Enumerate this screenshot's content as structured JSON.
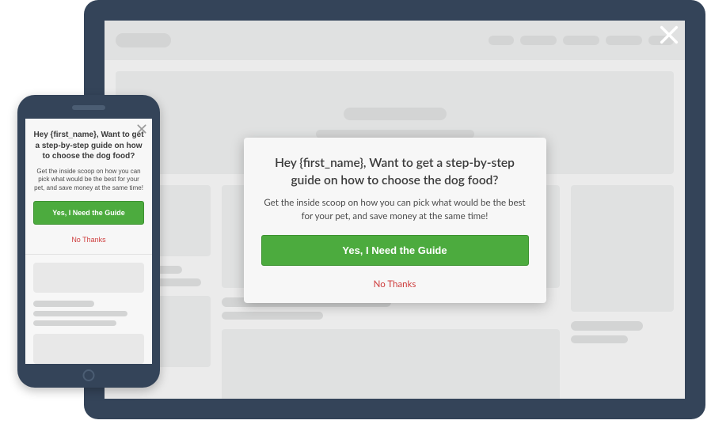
{
  "modal": {
    "heading": "Hey {first_name}, Want to get a step-by-step guide on how to choose the dog food?",
    "subtext": "Get the inside scoop on how you can pick what would be the best for your pet, and save money at the same time!",
    "accept_label": "Yes, I Need the Guide",
    "decline_label": "No Thanks"
  },
  "colors": {
    "device_bezel": "#344459",
    "accept_button": "#4CAB3E",
    "decline_text": "#CE3D3D"
  }
}
